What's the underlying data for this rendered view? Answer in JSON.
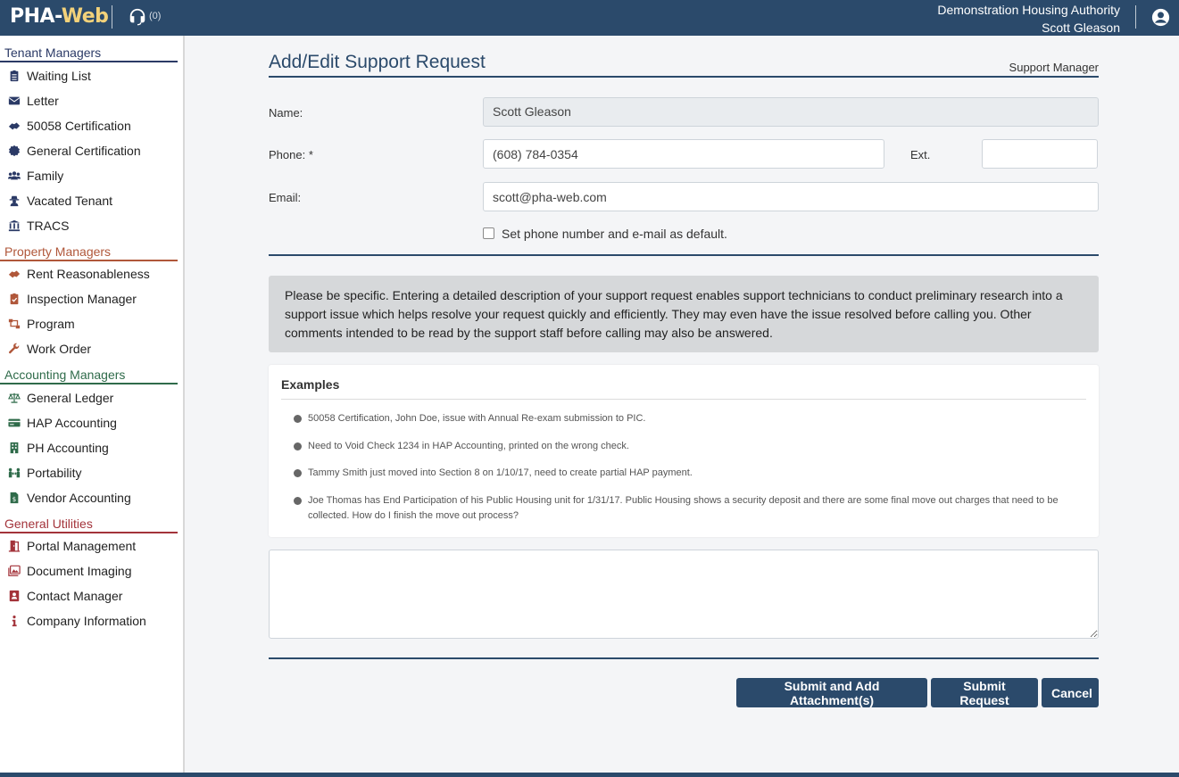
{
  "header": {
    "logo_prefix": "PHA-",
    "logo_suffix": "Web",
    "support_count": "(0)",
    "organization": "Demonstration Housing Authority",
    "user_name": "Scott Gleason"
  },
  "colors": {
    "brand": "#2b4a6b",
    "tenant": "#2b3a66",
    "property": "#b0573a",
    "accounting": "#2f6b4a",
    "utilities": "#a3333a"
  },
  "sidebar": {
    "sections": [
      {
        "title": "Tenant Managers",
        "items": [
          {
            "label": "Waiting List",
            "icon": "clipboard-list-icon"
          },
          {
            "label": "Letter",
            "icon": "envelope-icon"
          },
          {
            "label": "50058 Certification",
            "icon": "handshake-icon"
          },
          {
            "label": "General Certification",
            "icon": "certificate-icon"
          },
          {
            "label": "Family",
            "icon": "users-icon"
          },
          {
            "label": "Vacated Tenant",
            "icon": "user-secret-icon"
          },
          {
            "label": "TRACS",
            "icon": "landmark-icon"
          }
        ]
      },
      {
        "title": "Property Managers",
        "items": [
          {
            "label": "Rent Reasonableness",
            "icon": "handshake-icon"
          },
          {
            "label": "Inspection Manager",
            "icon": "clipboard-check-icon"
          },
          {
            "label": "Program",
            "icon": "sitemap-icon"
          },
          {
            "label": "Work Order",
            "icon": "wrench-icon"
          }
        ]
      },
      {
        "title": "Accounting Managers",
        "items": [
          {
            "label": "General Ledger",
            "icon": "balance-scale-icon"
          },
          {
            "label": "HAP Accounting",
            "icon": "credit-card-icon"
          },
          {
            "label": "PH Accounting",
            "icon": "building-icon"
          },
          {
            "label": "Portability",
            "icon": "people-arrows-icon"
          },
          {
            "label": "Vendor Accounting",
            "icon": "file-invoice-dollar-icon"
          }
        ]
      },
      {
        "title": "General Utilities",
        "items": [
          {
            "label": "Portal Management",
            "icon": "door-open-icon"
          },
          {
            "label": "Document Imaging",
            "icon": "images-icon"
          },
          {
            "label": "Contact Manager",
            "icon": "address-book-icon"
          },
          {
            "label": "Company Information",
            "icon": "info-icon"
          }
        ]
      }
    ]
  },
  "page": {
    "title": "Add/Edit Support Request",
    "subtitle": "Support Manager"
  },
  "form": {
    "name_label": "Name:",
    "name_value": "Scott Gleason",
    "phone_label": "Phone: *",
    "phone_value": "(608) 784-0354",
    "ext_label": "Ext.",
    "ext_value": "",
    "email_label": "Email:",
    "email_value": "scott@pha-web.com",
    "default_checkbox_label": "Set phone number and e-mail as default."
  },
  "info_text": "Please be specific. Entering a detailed description of your support request enables support technicians to conduct preliminary research into a support issue which helps resolve your request quickly and efficiently. They may even have the issue resolved before calling you. Other comments intended to be read by the support staff before calling may also be answered.",
  "examples": {
    "title": "Examples",
    "items": [
      "50058 Certification, John Doe, issue with Annual Re-exam submission to PIC.",
      "Need to Void Check 1234 in HAP Accounting, printed on the wrong check.",
      "Tammy Smith just moved into Section 8 on 1/10/17, need to create partial HAP payment.",
      "Joe Thomas has End Participation of his Public Housing unit for 1/31/17. Public Housing shows a security deposit and there are some final move out charges that need to be collected. How do I finish the move out process?"
    ]
  },
  "description_value": "",
  "buttons": {
    "submit_attach": "Submit and Add Attachment(s)",
    "submit": "Submit Request",
    "cancel": "Cancel"
  }
}
